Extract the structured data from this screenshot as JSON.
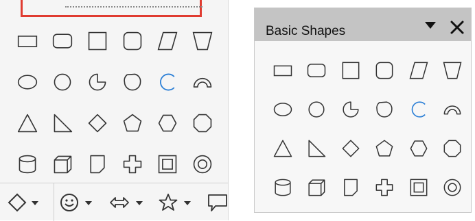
{
  "floating_window": {
    "title": "Basic Shapes"
  },
  "shapes": [
    [
      "rectangle-icon",
      "rounded-rectangle-icon",
      "square-icon",
      "rounded-square-icon",
      "parallelogram-icon",
      "trapezoid-icon"
    ],
    [
      "ellipse-icon",
      "circle-icon",
      "circle-pie-icon",
      "octagon-bevel-icon",
      "arc-icon",
      "block-arc-icon"
    ],
    [
      "isosceles-triangle-icon",
      "right-triangle-icon",
      "diamond-icon",
      "pentagon-icon",
      "hexagon-icon",
      "octagon-icon"
    ],
    [
      "cylinder-icon",
      "cube-icon",
      "folded-corner-icon",
      "cross-icon",
      "frame-icon",
      "ring-icon"
    ]
  ],
  "toolbar_split_buttons": [
    "diamond-icon",
    "smiley-icon",
    "double-arrow-icon",
    "star-icon",
    "callout-icon"
  ],
  "colors": {
    "highlight": "#e03c31",
    "icon_stroke": "#333333",
    "arc_blue": "#2b7fd6",
    "title_bar": "#c4c4c4"
  }
}
